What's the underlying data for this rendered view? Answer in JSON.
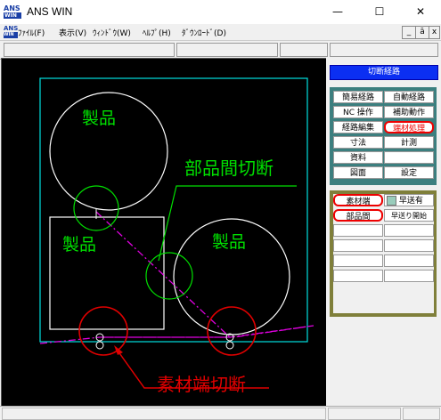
{
  "app": {
    "logo_top": "ANS",
    "logo_bottom": "WIN",
    "title": "ANS WIN"
  },
  "window_controls": {
    "minimize": "—",
    "maximize": "☐",
    "close": "✕"
  },
  "menu": {
    "items": [
      "ﾌｧｲﾙ(F)",
      "表示(V)",
      "ｳｨﾝﾄﾞｳ(W)",
      "ﾍﾙﾌﾟ(H)",
      "ﾀﾞｳﾝﾛｰﾄﾞ(D)"
    ],
    "mdi_controls": [
      "_",
      "ā",
      "x"
    ]
  },
  "canvas_labels": {
    "part_top": "製品",
    "part_left": "製品",
    "part_right": "製品",
    "between_parts_cut": "部品間切断",
    "material_edge_cut": "素材端切断"
  },
  "panel": {
    "header": "切断経路",
    "top_buttons": [
      [
        "簡易経路",
        "自動経路"
      ],
      [
        "NC 操作",
        "補助動作"
      ],
      [
        "経路編集",
        "端材処理"
      ],
      [
        "寸法",
        "計測"
      ],
      [
        "資料",
        ""
      ],
      [
        "図面",
        "設定"
      ]
    ],
    "bottom_buttons": [
      [
        "素材端",
        "早送有"
      ],
      [
        "部品間",
        "早送り開始"
      ]
    ]
  },
  "colors": {
    "canvas_bg": "#000000",
    "sheet_outline": "#00e0e0",
    "part_outline": "#ffffff",
    "label_green": "#00e000",
    "cut_circle_green": "#00e000",
    "cut_circle_red": "#e00000",
    "path_magenta": "#e000e0",
    "annotation_red": "#e00000",
    "highlight_red": "#e00000",
    "panel_header": "#0b2ff2"
  }
}
